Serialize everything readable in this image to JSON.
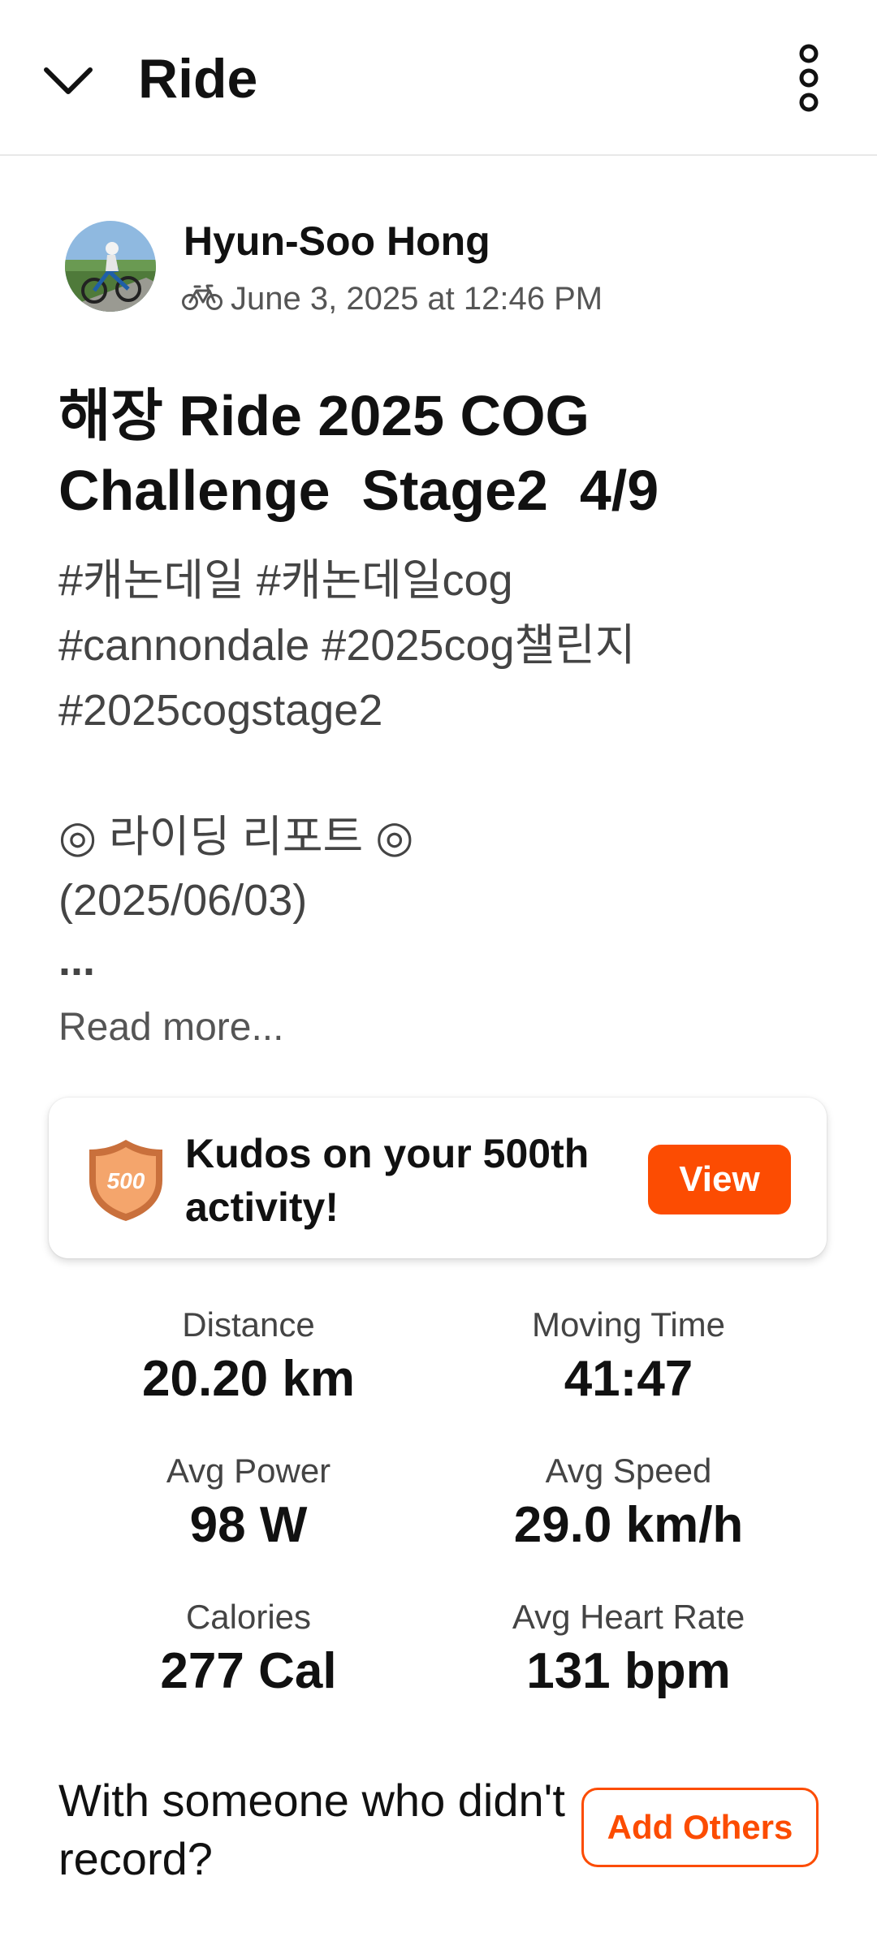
{
  "header": {
    "title": "Ride",
    "back_icon": "chevron-down-icon",
    "menu_icon": "more-vertical-icon"
  },
  "athlete": {
    "name": "Hyun-Soo Hong",
    "sport_icon": "bike-icon",
    "date": "June 3, 2025 at 12:46 PM"
  },
  "activity": {
    "title": "해장 Ride 2025 COG\nChallenge  Stage2  4/9",
    "description_lines": [
      "#캐논데일 #캐논데일cog",
      "#cannondale #2025cog챌린지",
      "#2025cogstage2",
      "◎ 라이딩 리포트 ◎",
      "(2025/06/03)",
      "..."
    ],
    "read_more": "Read more..."
  },
  "kudos": {
    "badge_text": "500",
    "message": "Kudos on your 500th activity!",
    "button": "View"
  },
  "stats": [
    {
      "label": "Distance",
      "value": "20.20 km"
    },
    {
      "label": "Moving Time",
      "value": "41:47"
    },
    {
      "label": "Avg Power",
      "value": "98 W"
    },
    {
      "label": "Avg Speed",
      "value": "29.0 km/h"
    },
    {
      "label": "Calories",
      "value": "277 Cal"
    },
    {
      "label": "Avg Heart Rate",
      "value": "131 bpm"
    }
  ],
  "add_others": {
    "prompt": "With someone who didn't record?",
    "button": "Add Others"
  },
  "colors": {
    "accent": "#fc4c02",
    "text": "#111111",
    "muted": "#555555"
  }
}
